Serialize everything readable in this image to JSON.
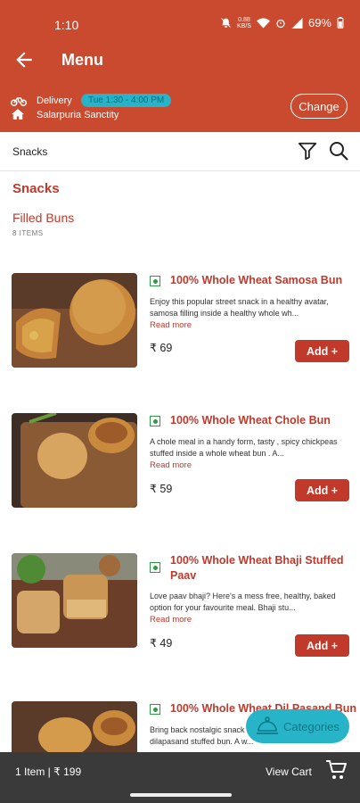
{
  "status_bar": {
    "time": "1:10",
    "data_rate_top": "0.88",
    "data_rate_bottom": "KB/S",
    "battery": "69%"
  },
  "header": {
    "title": "Menu"
  },
  "delivery": {
    "mode": "Delivery",
    "slot": "Tue 1:30 - 4:00 PM",
    "address": "Salarpuria Sanctity",
    "change_label": "Change"
  },
  "filter": {
    "label": "Snacks"
  },
  "section": {
    "title": "Snacks",
    "subtitle": "Filled Buns",
    "count": "8 ITEMS"
  },
  "items": [
    {
      "name": "100% Whole Wheat Samosa Bun",
      "description": "Enjoy this popular street snack in a healthy avatar, samosa filling inside a healthy whole wh...",
      "read_more": "Read more",
      "price": "₹ 69",
      "add_label": "Add +"
    },
    {
      "name": "100% Whole Wheat Chole Bun",
      "description": "A chole meal in a handy form, tasty , spicy chickpeas stuffed inside a whole wheat bun . A...",
      "read_more": "Read more",
      "price": "₹ 59",
      "add_label": "Add +"
    },
    {
      "name": "100% Whole Wheat Bhaji Stuffed Paav",
      "description": "Love paav bhaji? Here's a mess free, healthy, baked option for your favourite meal. Bhaji stu...",
      "read_more": "Read more",
      "price": "₹ 49",
      "add_label": "Add +"
    },
    {
      "name": "100% Whole Wheat Dil Pasand Bun",
      "description": "Bring back nostalgic snack childhood with our dilapasand stuffed bun. A w...",
      "read_more": "",
      "price": "",
      "add_label": ""
    }
  ],
  "fab": {
    "label": "Categories"
  },
  "cart": {
    "summary": "1 Item | ₹ 199",
    "view_label": "View Cart"
  },
  "colors": {
    "brand": "#c94a2e",
    "accent": "#28b4c8",
    "veg": "#2e9b47",
    "cartbar": "#3a3a3a"
  }
}
